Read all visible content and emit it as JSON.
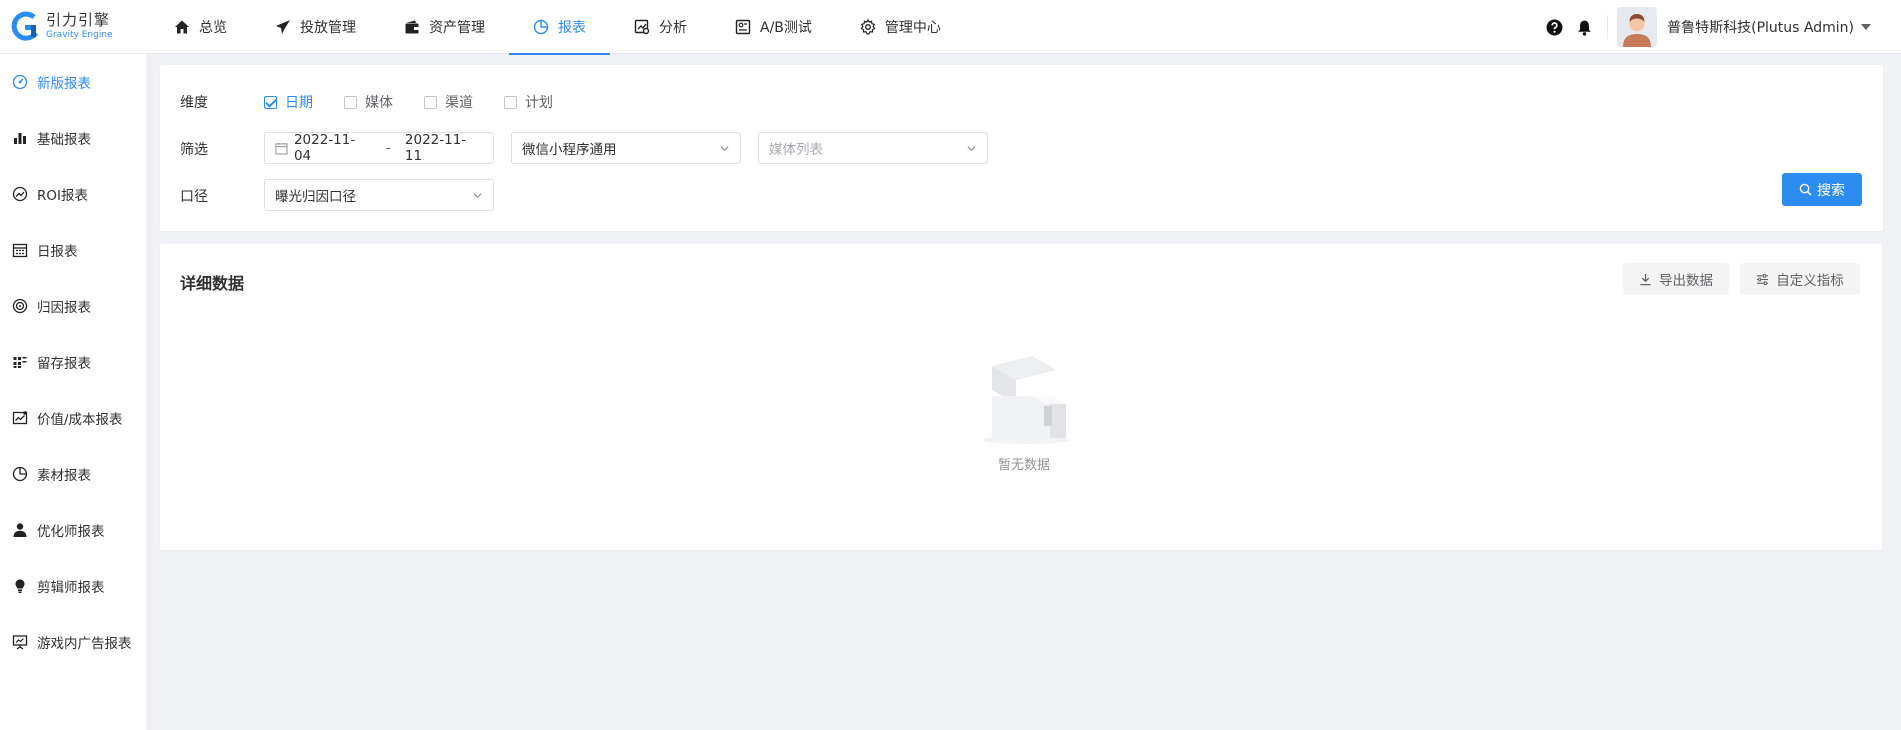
{
  "app": {
    "logo_cn": "引力引擎",
    "logo_en": "Gravity Engine",
    "accent": "#2d8cf0"
  },
  "nav": {
    "items": [
      {
        "label": "总览",
        "icon": "home-icon"
      },
      {
        "label": "投放管理",
        "icon": "send-icon"
      },
      {
        "label": "资产管理",
        "icon": "wallet-icon"
      },
      {
        "label": "报表",
        "icon": "pie-chart-icon",
        "active": true
      },
      {
        "label": "分析",
        "icon": "analysis-icon"
      },
      {
        "label": "A/B测试",
        "icon": "ab-test-icon"
      },
      {
        "label": "管理中心",
        "icon": "gear-icon"
      }
    ]
  },
  "user": {
    "name": "普鲁特斯科技(Plutus Admin)"
  },
  "sidebar": {
    "items": [
      {
        "label": "新版报表",
        "icon": "dashboard-icon",
        "active": true
      },
      {
        "label": "基础报表",
        "icon": "bar-chart-icon"
      },
      {
        "label": "ROI报表",
        "icon": "trend-icon"
      },
      {
        "label": "日报表",
        "icon": "calendar-icon"
      },
      {
        "label": "归因报表",
        "icon": "target-icon"
      },
      {
        "label": "留存报表",
        "icon": "grid-icon"
      },
      {
        "label": "价值/成本报表",
        "icon": "value-chart-icon"
      },
      {
        "label": "素材报表",
        "icon": "pie-icon"
      },
      {
        "label": "优化师报表",
        "icon": "user-icon"
      },
      {
        "label": "剪辑师报表",
        "icon": "bulb-icon"
      },
      {
        "label": "游戏内广告报表",
        "icon": "presentation-icon"
      }
    ]
  },
  "filters": {
    "dimension_label": "维度",
    "dimensions": [
      {
        "label": "日期",
        "checked": true
      },
      {
        "label": "媒体",
        "checked": false
      },
      {
        "label": "渠道",
        "checked": false
      },
      {
        "label": "计划",
        "checked": false
      }
    ],
    "filter_label": "筛选",
    "date_start": "2022-11-04",
    "date_sep": "-",
    "date_end": "2022-11-11",
    "app_select": "微信小程序通用",
    "media_placeholder": "媒体列表",
    "caliber_label": "口径",
    "caliber_select": "曝光归因口径",
    "search_label": "搜索"
  },
  "detail": {
    "title": "详细数据",
    "export_label": "导出数据",
    "custom_label": "自定义指标",
    "empty_text": "暂无数据"
  }
}
